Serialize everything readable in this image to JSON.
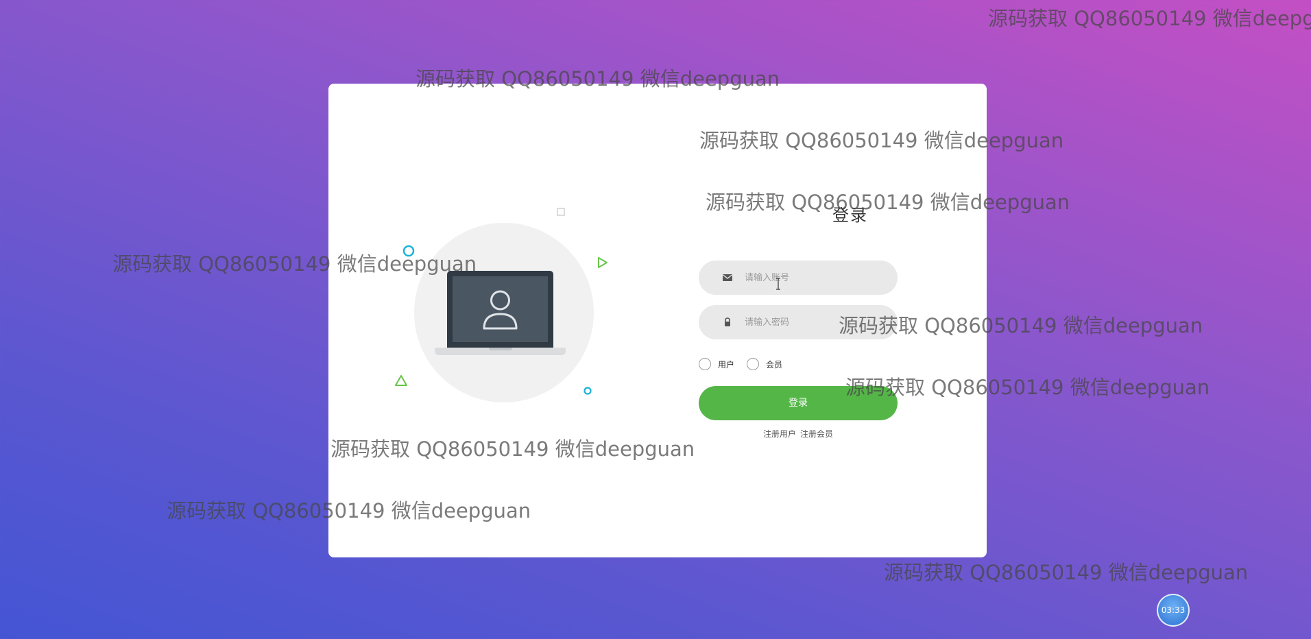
{
  "login": {
    "title": "登录",
    "account_placeholder": "请输入账号",
    "password_placeholder": "请输入密码",
    "account_value": "",
    "password_value": "",
    "roles": [
      {
        "label": "用户",
        "checked": false
      },
      {
        "label": "会员",
        "checked": false
      }
    ],
    "submit_label": "登录",
    "register_links": [
      "注册用户",
      "注册会员"
    ]
  },
  "icons": {
    "account_icon": "envelope-icon",
    "password_icon": "lock-icon",
    "illustration": "laptop-user-icon"
  },
  "watermark_text": "源码获取 QQ86050149 微信deepguan",
  "timer": "03:33",
  "colors": {
    "background_start": "#c44fc4",
    "background_end": "#4455d4",
    "card": "#ffffff",
    "field": "#e9e9e9",
    "button": "#55b648",
    "accent_cyan": "#1ab3d6",
    "accent_green": "#67c34b"
  }
}
